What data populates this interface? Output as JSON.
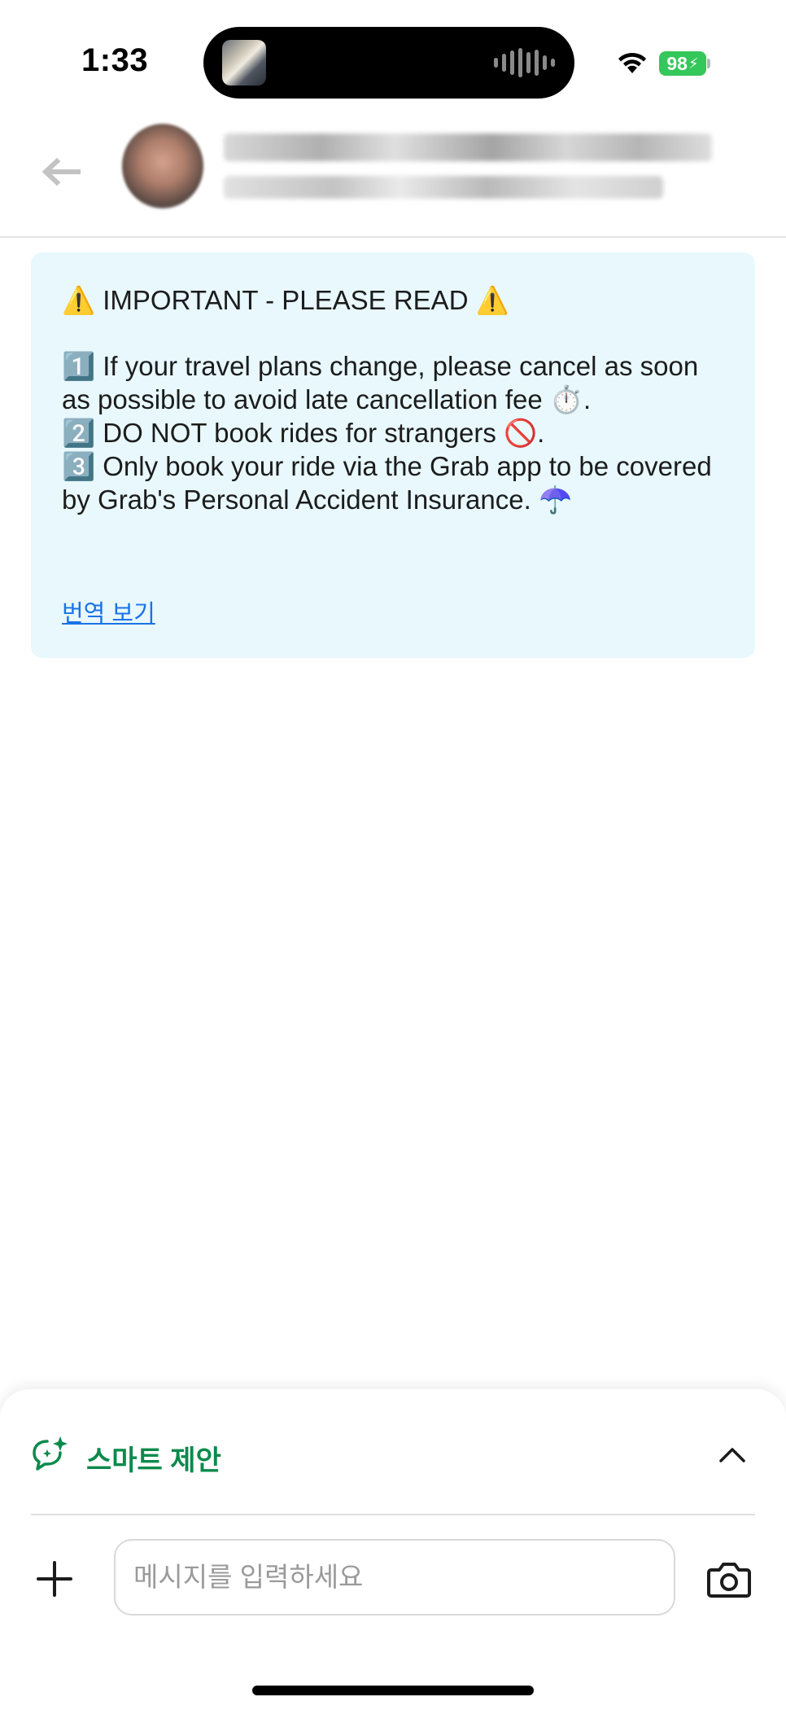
{
  "status_bar": {
    "time": "1:33",
    "battery": "98"
  },
  "header": {
    "back_icon": "arrow-left-icon",
    "contact_name": "",
    "contact_subtitle": ""
  },
  "notice": {
    "background": "#e8f8fd",
    "title": "⚠️ IMPORTANT - PLEASE READ ⚠️",
    "lines": [
      "1️⃣ If your travel plans change, please cancel as soon as possible to avoid late cancellation fee ⏱️.",
      "2️⃣ DO NOT book rides for strangers 🚫.",
      "3️⃣ Only book your ride via the Grab app to be covered by Grab's Personal Accident Insurance. ☂️"
    ],
    "translate_link": "번역 보기"
  },
  "composer": {
    "smart_suggestion_label": "스마트 제안",
    "smart_suggestion_icon": "sparkle-chat-icon",
    "collapse_icon": "chevron-up-icon",
    "add_icon": "plus-icon",
    "message_placeholder": "메시지를 입력하세요",
    "message_value": "",
    "camera_icon": "camera-icon",
    "accent_color": "#0b8a4b"
  }
}
